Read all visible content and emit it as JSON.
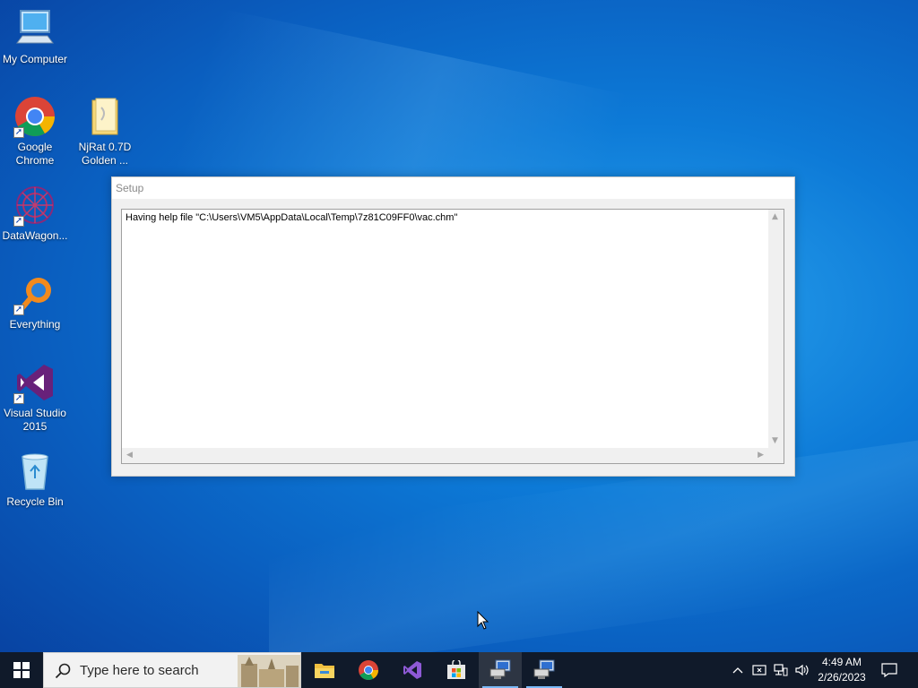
{
  "desktop": {
    "icons": [
      {
        "label": "My Computer"
      },
      {
        "label": "Google Chrome"
      },
      {
        "label": "NjRat 0.7D Golden ..."
      },
      {
        "label": "DataWagon..."
      },
      {
        "label": "Everything"
      },
      {
        "label": "Visual Studio 2015"
      },
      {
        "label": "Recycle Bin"
      }
    ]
  },
  "setup_window": {
    "title": "Setup",
    "text": "Having help file \"C:\\Users\\VM5\\AppData\\Local\\Temp\\7z81C09FF0\\vac.chm\""
  },
  "taskbar": {
    "search_placeholder": "Type here to search",
    "pinned": [
      "file-explorer-icon",
      "chrome-icon",
      "visual-studio-icon",
      "microsoft-store-icon",
      "setup-app-icon",
      "setup-app-icon"
    ],
    "time": "4:49 AM",
    "date": "2/26/2023"
  },
  "colors": {
    "taskbar_bg": "#101a2a",
    "accent": "#7ab8f5",
    "desktop_blue": "#0d7ad7"
  }
}
